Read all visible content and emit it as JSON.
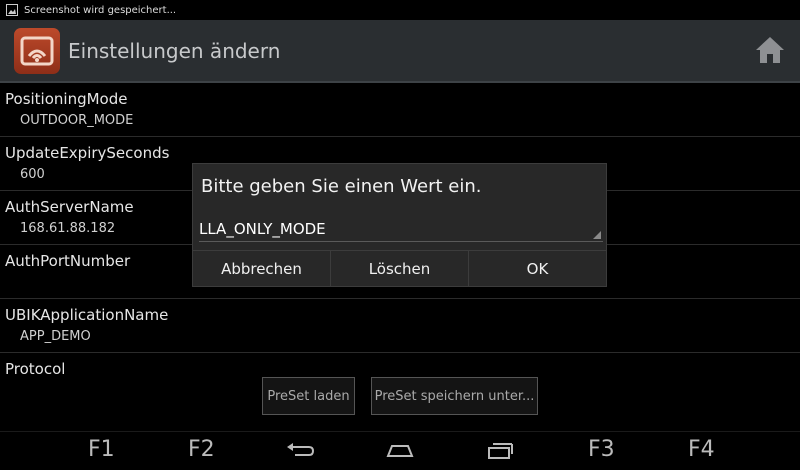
{
  "status_bar": {
    "notification_text": "Screenshot wird gespeichert..."
  },
  "action_bar": {
    "title": "Einstellungen ändern"
  },
  "settings": [
    {
      "title": "PositioningMode",
      "value": "OUTDOOR_MODE"
    },
    {
      "title": "UpdateExpirySeconds",
      "value": "600"
    },
    {
      "title": "AuthServerName",
      "value": "168.61.88.182"
    },
    {
      "title": "AuthPortNumber",
      "value": ""
    },
    {
      "title": "UBIKApplicationName",
      "value": "APP_DEMO"
    },
    {
      "title": "Protocol",
      "value": ""
    }
  ],
  "preset_buttons": {
    "load": "PreSet laden",
    "save_as": "PreSet speichern unter..."
  },
  "dialog": {
    "title": "Bitte geben Sie einen Wert ein.",
    "input_value": "LLA_ONLY_MODE",
    "buttons": {
      "cancel": "Abbrechen",
      "clear": "Löschen",
      "ok": "OK"
    }
  },
  "nav_bar": {
    "f1": "F1",
    "f2": "F2",
    "f3": "F3",
    "f4": "F4"
  },
  "colors": {
    "action_bar_bg": "#2a2e31",
    "app_icon": "#bd4a2b",
    "dialog_bg": "#282828"
  }
}
